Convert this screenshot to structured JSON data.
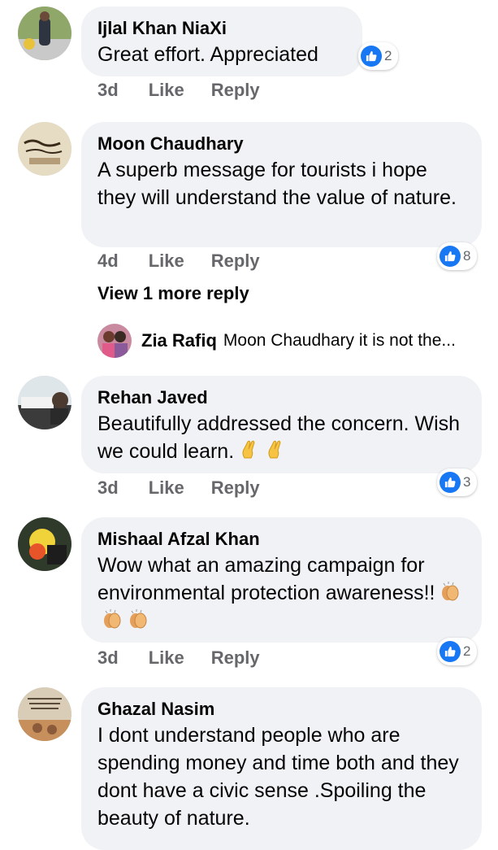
{
  "comments": [
    {
      "name": "Ijlal Khan NiaXi",
      "text": "Great effort. Appreciated",
      "age": "3d",
      "like_label": "Like",
      "reply_label": "Reply",
      "reaction_count": "2"
    },
    {
      "name": "Moon Chaudhary",
      "text": "A superb message for tourists i hope they will understand the value of nature.",
      "age": "4d",
      "like_label": "Like",
      "reply_label": "Reply",
      "reaction_count": "8",
      "view_more": "View 1 more reply",
      "reply_preview": {
        "name": "Zia Rafiq",
        "text": "Moon Chaudhary it is not the..."
      }
    },
    {
      "name": "Rehan Javed",
      "text": "Beautifully addressed the concern. Wish we could learn.",
      "emoji": [
        "crossed-fingers",
        "crossed-fingers"
      ],
      "age": "3d",
      "like_label": "Like",
      "reply_label": "Reply",
      "reaction_count": "3"
    },
    {
      "name": "Mishaal Afzal Khan",
      "text": "Wow what an amazing campaign for environmental protection awareness!!",
      "emoji": [
        "clapping-hands",
        "clapping-hands",
        "clapping-hands"
      ],
      "age": "3d",
      "like_label": "Like",
      "reply_label": "Reply",
      "reaction_count": "2"
    },
    {
      "name": "Ghazal Nasim",
      "text": "I dont understand people who are spending money and time both and they dont have a civic sense .Spoiling the beauty of nature."
    }
  ],
  "colors": {
    "bubble": "#f0f2f5",
    "meta": "#65676b",
    "like_blue": "#1877f2"
  },
  "icons": [
    "like-icon",
    "crossed-fingers-emoji",
    "clapping-hands-emoji"
  ]
}
